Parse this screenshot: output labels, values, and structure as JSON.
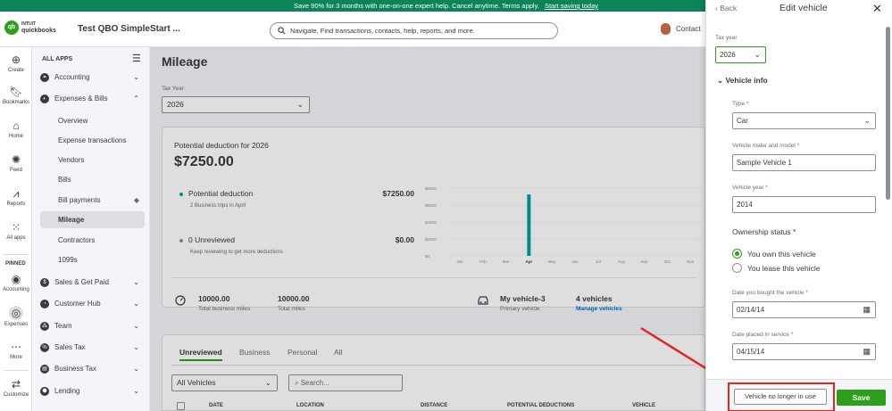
{
  "banner": {
    "text": "Save 90% for 3 months with one-on-one expert help. Cancel anytime. Terms apply.",
    "link": "Start saving today"
  },
  "header": {
    "logo_line1": "INTUIT",
    "logo_line2": "quickbooks",
    "logo_mark": "qb",
    "company": "Test QBO SimpleStart ...",
    "search_placeholder": "Navigate, Find transactions, contacts, help, reports, and more.",
    "contact": "Contact"
  },
  "rail": {
    "items": [
      {
        "label": "Create",
        "icon": "plus-icon"
      },
      {
        "label": "Bookmarks",
        "icon": "bookmark-icon"
      },
      {
        "label": "Home",
        "icon": "home-icon"
      },
      {
        "label": "Feed",
        "icon": "feed-icon"
      },
      {
        "label": "Reports",
        "icon": "reports-icon"
      },
      {
        "label": "All apps",
        "icon": "apps-icon"
      }
    ],
    "pinned_label": "PINNED",
    "pinned": [
      {
        "label": "Accounting",
        "icon": "accounting-icon"
      },
      {
        "label": "Expenses",
        "icon": "expenses-icon"
      },
      {
        "label": "More",
        "icon": "more-icon"
      },
      {
        "label": "Customize",
        "icon": "customize-icon"
      }
    ]
  },
  "appnav": {
    "heading": "ALL APPS",
    "groups": [
      {
        "label": "Accounting",
        "expanded": false
      },
      {
        "label": "Expenses & Bills",
        "expanded": true
      }
    ],
    "subitems": [
      "Overview",
      "Expense transactions",
      "Vendors",
      "Bills",
      "Bill payments",
      "Mileage",
      "Contractors",
      "1099s"
    ],
    "active_subitem": "Mileage",
    "more_groups": [
      "Sales & Get Paid",
      "Customer Hub",
      "Team",
      "Sales Tax",
      "Business Tax",
      "Lending"
    ]
  },
  "main": {
    "title": "Mileage",
    "tax_year_label": "Tax Year:",
    "tax_year_value": "2026",
    "potential_label": "Potential deduction for 2026",
    "potential_value": "$7250.00",
    "row1": {
      "label": "Potential deduction",
      "sub": "2 Business trips in April",
      "amount": "$7250.00",
      "color": "#00a0a0"
    },
    "row2": {
      "label": "0 Unreviewed",
      "sub": "Keep reviewing to get more deductions",
      "amount": "$0.00",
      "color": "#8d9096"
    },
    "summary": {
      "business_miles": "10000.00",
      "business_miles_label": "Total business miles",
      "total_miles": "10000.00",
      "total_miles_label": "Total miles",
      "vehicle_name": "My vehicle-3",
      "vehicle_sub": "Primary vehicle",
      "vehicle_count": "4 vehicles",
      "manage_link": "Manage vehicles"
    },
    "tabs": [
      "Unreviewed",
      "Business",
      "Personal",
      "All"
    ],
    "active_tab": "Unreviewed",
    "vehicle_filter": "All Vehicles",
    "search_placeholder": "Search...",
    "table_headers": [
      "DATE",
      "LOCATION",
      "DISTANCE",
      "POTENTIAL DEDUCTIONS",
      "VEHICLE"
    ]
  },
  "chart_data": {
    "type": "bar",
    "categories": [
      "Jan",
      "Feb",
      "Mar",
      "Apr",
      "May",
      "Jun",
      "Jul",
      "Aug",
      "Sep",
      "Oct",
      "Nov"
    ],
    "values": [
      0,
      0,
      0,
      7250,
      0,
      0,
      0,
      0,
      0,
      0,
      0
    ],
    "y_ticks": [
      "$8000",
      "$6000",
      "$4000",
      "$2000",
      "$0"
    ],
    "ylim": [
      0,
      8000
    ],
    "bar_color": "#00a0a0"
  },
  "panel": {
    "back": "Back",
    "title": "Edit vehicle",
    "tax_year_label": "Tax year",
    "tax_year_value": "2026",
    "section": "Vehicle info",
    "type_label": "Type *",
    "type_value": "Car",
    "make_label": "Vehicle make and model *",
    "make_value": "Sample Vehicle 1",
    "year_label": "Vehicle year *",
    "year_value": "2014",
    "ownership_label": "Ownership status *",
    "own_option": "You own this vehicle",
    "lease_option": "You lease this vehicle",
    "bought_label": "Date you bought the vehicle *",
    "bought_value": "02/14/14",
    "placed_label": "Date placed in service *",
    "placed_value": "04/15/14",
    "no_longer_button": "Vehicle no longer in use",
    "save_button": "Save"
  }
}
